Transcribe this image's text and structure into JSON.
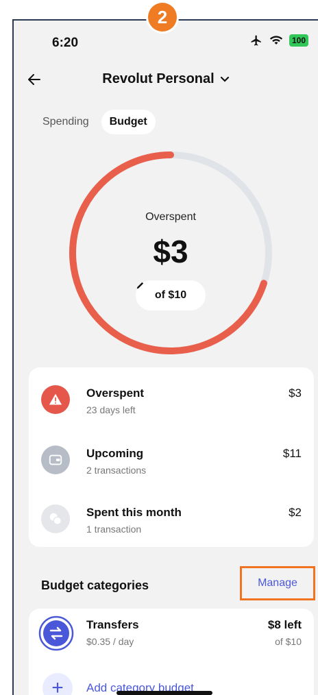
{
  "step_badge": "2",
  "status_bar": {
    "time": "6:20",
    "battery": "100"
  },
  "header": {
    "title": "Revolut Personal"
  },
  "tabs": [
    {
      "label": "Spending"
    },
    {
      "label": "Budget"
    }
  ],
  "budget_ring": {
    "label": "Overspent",
    "amount": "$3",
    "total": "of $10",
    "progress_fraction": 1.3,
    "track_color": "#e0e3e8",
    "fill_color": "#e8604c"
  },
  "summary": [
    {
      "title": "Overspent",
      "subtitle": "23 days left",
      "value": "$3",
      "icon": "warning-icon",
      "icon_bg": "#e5574b"
    },
    {
      "title": "Upcoming",
      "subtitle": "2 transactions",
      "value": "$11",
      "icon": "wallet-icon",
      "icon_bg": "#b6bdc6"
    },
    {
      "title": "Spent this month",
      "subtitle": "1 transaction",
      "value": "$2",
      "icon": "coins-icon",
      "icon_bg": "#e4e6ea"
    }
  ],
  "budget_categories": {
    "title": "Budget categories",
    "manage_label": "Manage",
    "items": [
      {
        "name": "Transfers",
        "rate": "$0.35 / day",
        "left": "$8 left",
        "of": "of $10",
        "icon": "transfer-icon",
        "color": "#4a57d8"
      }
    ],
    "add_label": "Add category budget"
  }
}
